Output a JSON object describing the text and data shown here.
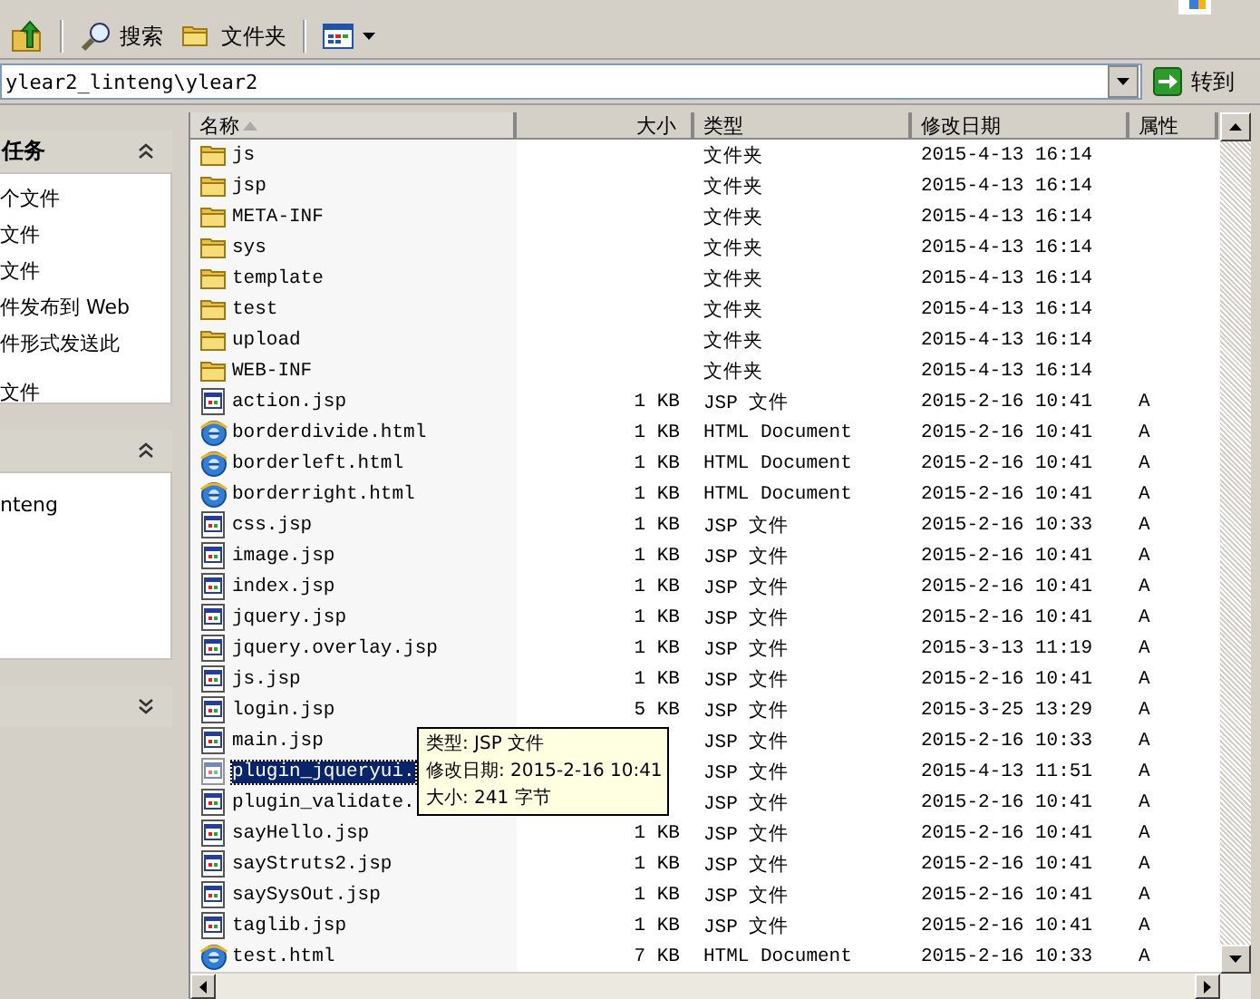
{
  "toolbar": {
    "buttons": [
      {
        "kind": "up"
      },
      {
        "kind": "search",
        "label": "搜索"
      },
      {
        "kind": "folders",
        "label": "文件夹"
      },
      {
        "kind": "views"
      }
    ]
  },
  "address_bar": {
    "value": "ylear2_linteng\\ylear2",
    "go_label": "转到"
  },
  "sidebar": {
    "panels": [
      {
        "title": "任务",
        "expanded": true,
        "items": [
          "个文件",
          "文件",
          "文件",
          "件发布到 Web",
          "件形式发送此",
          "文件"
        ]
      },
      {
        "expanded": true,
        "items": [
          "nteng"
        ]
      },
      {
        "expanded": false
      }
    ]
  },
  "table": {
    "columns": [
      {
        "label": "名称",
        "sorted": true
      },
      {
        "label": "大小"
      },
      {
        "label": "类型"
      },
      {
        "label": "修改日期"
      },
      {
        "label": "属性"
      }
    ],
    "rows": [
      {
        "kind": "folder",
        "name": "js",
        "type": "文件夹",
        "date": "2015-4-13 16:14",
        "selected": false
      },
      {
        "kind": "folder",
        "name": "jsp",
        "type": "文件夹",
        "date": "2015-4-13 16:14",
        "selected": false
      },
      {
        "kind": "folder",
        "name": "META-INF",
        "type": "文件夹",
        "date": "2015-4-13 16:14",
        "selected": false
      },
      {
        "kind": "folder",
        "name": "sys",
        "type": "文件夹",
        "date": "2015-4-13 16:14",
        "selected": false
      },
      {
        "kind": "folder",
        "name": "template",
        "type": "文件夹",
        "date": "2015-4-13 16:14",
        "selected": false
      },
      {
        "kind": "folder",
        "name": "test",
        "type": "文件夹",
        "date": "2015-4-13 16:14",
        "selected": false
      },
      {
        "kind": "folder",
        "name": "upload",
        "type": "文件夹",
        "date": "2015-4-13 16:14",
        "selected": false
      },
      {
        "kind": "folder",
        "name": "WEB-INF",
        "type": "文件夹",
        "date": "2015-4-13 16:14",
        "selected": false
      },
      {
        "kind": "jsp",
        "name": "action.jsp",
        "size": "1 KB",
        "type": "JSP 文件",
        "date": "2015-2-16 10:41",
        "attr": "A",
        "selected": false
      },
      {
        "kind": "html",
        "name": "borderdivide.html",
        "size": "1 KB",
        "type": "HTML Document",
        "date": "2015-2-16 10:41",
        "attr": "A",
        "selected": false
      },
      {
        "kind": "html",
        "name": "borderleft.html",
        "size": "1 KB",
        "type": "HTML Document",
        "date": "2015-2-16 10:41",
        "attr": "A",
        "selected": false
      },
      {
        "kind": "html",
        "name": "borderright.html",
        "size": "1 KB",
        "type": "HTML Document",
        "date": "2015-2-16 10:41",
        "attr": "A",
        "selected": false
      },
      {
        "kind": "jsp",
        "name": "css.jsp",
        "size": "1 KB",
        "type": "JSP 文件",
        "date": "2015-2-16 10:33",
        "attr": "A",
        "selected": false
      },
      {
        "kind": "jsp",
        "name": "image.jsp",
        "size": "1 KB",
        "type": "JSP 文件",
        "date": "2015-2-16 10:41",
        "attr": "A",
        "selected": false
      },
      {
        "kind": "jsp",
        "name": "index.jsp",
        "size": "1 KB",
        "type": "JSP 文件",
        "date": "2015-2-16 10:41",
        "attr": "A",
        "selected": false
      },
      {
        "kind": "jsp",
        "name": "jquery.jsp",
        "size": "1 KB",
        "type": "JSP 文件",
        "date": "2015-2-16 10:41",
        "attr": "A",
        "selected": false
      },
      {
        "kind": "jsp",
        "name": "jquery.overlay.jsp",
        "size": "1 KB",
        "type": "JSP 文件",
        "date": "2015-3-13 11:19",
        "attr": "A",
        "selected": false
      },
      {
        "kind": "jsp",
        "name": "js.jsp",
        "size": "1 KB",
        "type": "JSP 文件",
        "date": "2015-2-16 10:41",
        "attr": "A",
        "selected": false
      },
      {
        "kind": "jsp",
        "name": "login.jsp",
        "size": "5 KB",
        "type": "JSP 文件",
        "date": "2015-3-25 13:29",
        "attr": "A",
        "selected": false
      },
      {
        "kind": "jsp",
        "name": "main.jsp",
        "type": "JSP 文件",
        "date": "2015-2-16 10:33",
        "attr": "A",
        "selected": false
      },
      {
        "kind": "jsp",
        "name": "plugin_jqueryui.",
        "type": "JSP 文件",
        "date": "2015-4-13 11:51",
        "attr": "A",
        "selected": true
      },
      {
        "kind": "jsp",
        "name": "plugin_validate.",
        "type": "JSP 文件",
        "date": "2015-2-16 10:41",
        "attr": "A",
        "selected": false
      },
      {
        "kind": "jsp",
        "name": "sayHello.jsp",
        "size": "1 KB",
        "type": "JSP 文件",
        "date": "2015-2-16 10:41",
        "attr": "A",
        "selected": false
      },
      {
        "kind": "jsp",
        "name": "sayStruts2.jsp",
        "size": "1 KB",
        "type": "JSP 文件",
        "date": "2015-2-16 10:41",
        "attr": "A",
        "selected": false
      },
      {
        "kind": "jsp",
        "name": "saySysOut.jsp",
        "size": "1 KB",
        "type": "JSP 文件",
        "date": "2015-2-16 10:41",
        "attr": "A",
        "selected": false
      },
      {
        "kind": "jsp",
        "name": "taglib.jsp",
        "size": "1 KB",
        "type": "JSP 文件",
        "date": "2015-2-16 10:41",
        "attr": "A",
        "selected": false
      },
      {
        "kind": "html",
        "name": "test.html",
        "size": "7 KB",
        "type": "HTML Document",
        "date": "2015-2-16 10:33",
        "attr": "A",
        "selected": false
      }
    ]
  },
  "tooltip": {
    "lines": [
      "类型: JSP 文件",
      "修改日期: 2015-2-16 10:41",
      "大小: 241 字节"
    ]
  }
}
